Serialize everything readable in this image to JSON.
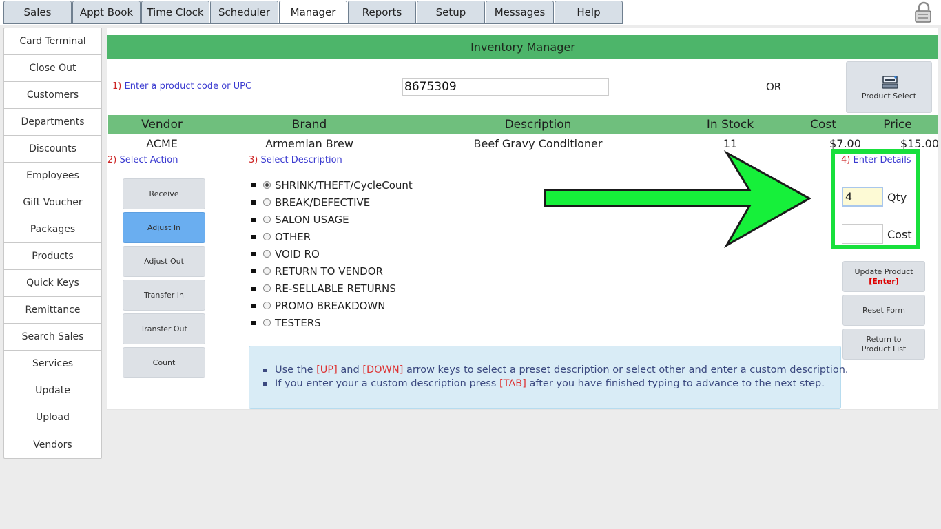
{
  "tabs": [
    {
      "label": "Sales",
      "active": false
    },
    {
      "label": "Appt Book",
      "active": false
    },
    {
      "label": "Time Clock",
      "active": false
    },
    {
      "label": "Scheduler",
      "active": false
    },
    {
      "label": "Manager",
      "active": true
    },
    {
      "label": "Reports",
      "active": false
    },
    {
      "label": "Setup",
      "active": false
    },
    {
      "label": "Messages",
      "active": false
    },
    {
      "label": "Help",
      "active": false
    }
  ],
  "sidebar": {
    "items": [
      "Card Terminal",
      "Close Out",
      "Customers",
      "Departments",
      "Discounts",
      "Employees",
      "Gift Voucher",
      "Packages",
      "Products",
      "Quick Keys",
      "Remittance",
      "Search Sales",
      "Services",
      "Update",
      "Upload",
      "Vendors"
    ]
  },
  "panel": {
    "title": "Inventory Manager",
    "step1": {
      "num": "1)",
      "label": "Enter a product code or UPC"
    },
    "product_code": "8675309",
    "or_label": "OR",
    "product_select_label": "Product Select",
    "table": {
      "headers": [
        "Vendor",
        "Brand",
        "Description",
        "In Stock",
        "Cost",
        "Price"
      ],
      "row": [
        "ACME",
        "Armemian Brew",
        "Beef Gravy Conditioner",
        "11",
        "$7.00",
        "$15.00"
      ]
    },
    "step2": {
      "num": "2)",
      "label": "Select Action"
    },
    "actions": [
      {
        "label": "Receive",
        "active": false
      },
      {
        "label": "Adjust In",
        "active": true
      },
      {
        "label": "Adjust Out",
        "active": false
      },
      {
        "label": "Transfer In",
        "active": false
      },
      {
        "label": "Transfer Out",
        "active": false
      },
      {
        "label": "Count",
        "active": false
      }
    ],
    "step3": {
      "num": "3)",
      "label": "Select Description"
    },
    "descriptions": [
      {
        "label": "SHRINK/THEFT/CycleCount",
        "selected": true
      },
      {
        "label": "BREAK/DEFECTIVE",
        "selected": false
      },
      {
        "label": "SALON USAGE",
        "selected": false
      },
      {
        "label": "OTHER",
        "selected": false
      },
      {
        "label": "VOID RO",
        "selected": false
      },
      {
        "label": "RETURN TO VENDOR",
        "selected": false
      },
      {
        "label": "RE-SELLABLE RETURNS",
        "selected": false
      },
      {
        "label": "PROMO BREAKDOWN",
        "selected": false
      },
      {
        "label": "TESTERS",
        "selected": false
      }
    ],
    "info": {
      "line1": {
        "pre": "Use the ",
        "key1": "[UP]",
        "mid": " and ",
        "key2": "[DOWN]",
        "post": " arrow keys to select a preset description or select other and enter a custom description."
      },
      "line2": {
        "pre": "If you enter your a custom description press ",
        "key": "[TAB]",
        "post": " after you have finished typing to advance to the next step."
      }
    },
    "step4": {
      "num": "4)",
      "label": "Enter Details"
    },
    "qty_value": "4",
    "qty_label": "Qty",
    "cost_value": "",
    "cost_label": "Cost",
    "buttons": {
      "update": "Update Product",
      "update_hint": "[Enter]",
      "reset": "Reset Form",
      "return": "Return to Product List"
    }
  },
  "colors": {
    "accent_green": "#4db56a",
    "annotation_green": "#18e03c",
    "active_action": "#6aaef0"
  },
  "icons": [
    "lock-icon",
    "register-icon"
  ]
}
